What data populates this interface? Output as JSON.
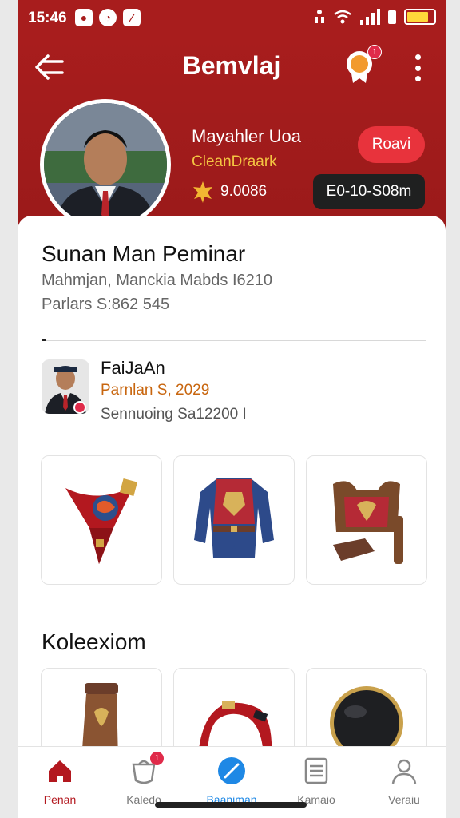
{
  "status": {
    "time": "15:46"
  },
  "header": {
    "title": "Bemvlaj",
    "notif_count": "1"
  },
  "profile": {
    "name": "Mayahler Uoa",
    "handle": "CleanDraark",
    "coins": "9.0086",
    "follow_label": "Roavi",
    "range": "E0-10-S08m"
  },
  "card": {
    "title": "Sunan Man Peminar",
    "subtitle": "Mahmjan, Manckia Mabds I6210",
    "price": "Parlars S:862 545"
  },
  "related": {
    "name": "FaiJaAn",
    "date": "Parnlan S, 2029",
    "info": "Sennuoing Sa12200 I"
  },
  "items": [
    {
      "name": "pennant-icon"
    },
    {
      "name": "armor-jacket-icon"
    },
    {
      "name": "leather-armor-icon"
    }
  ],
  "collection": {
    "title": "Koleexiom"
  },
  "nav": [
    {
      "label": "Penan",
      "icon": "home-icon"
    },
    {
      "label": "Kaledo",
      "icon": "bag-icon",
      "badge": "1"
    },
    {
      "label": "Baaniman",
      "icon": "compass-icon"
    },
    {
      "label": "Kamaio",
      "icon": "list-icon"
    },
    {
      "label": "Veraiu",
      "icon": "profile-icon"
    }
  ],
  "colors": {
    "brand": "#a81d1d",
    "accent": "#e8333c",
    "active_nav": "#1e88e5",
    "gold": "#f4c542"
  }
}
